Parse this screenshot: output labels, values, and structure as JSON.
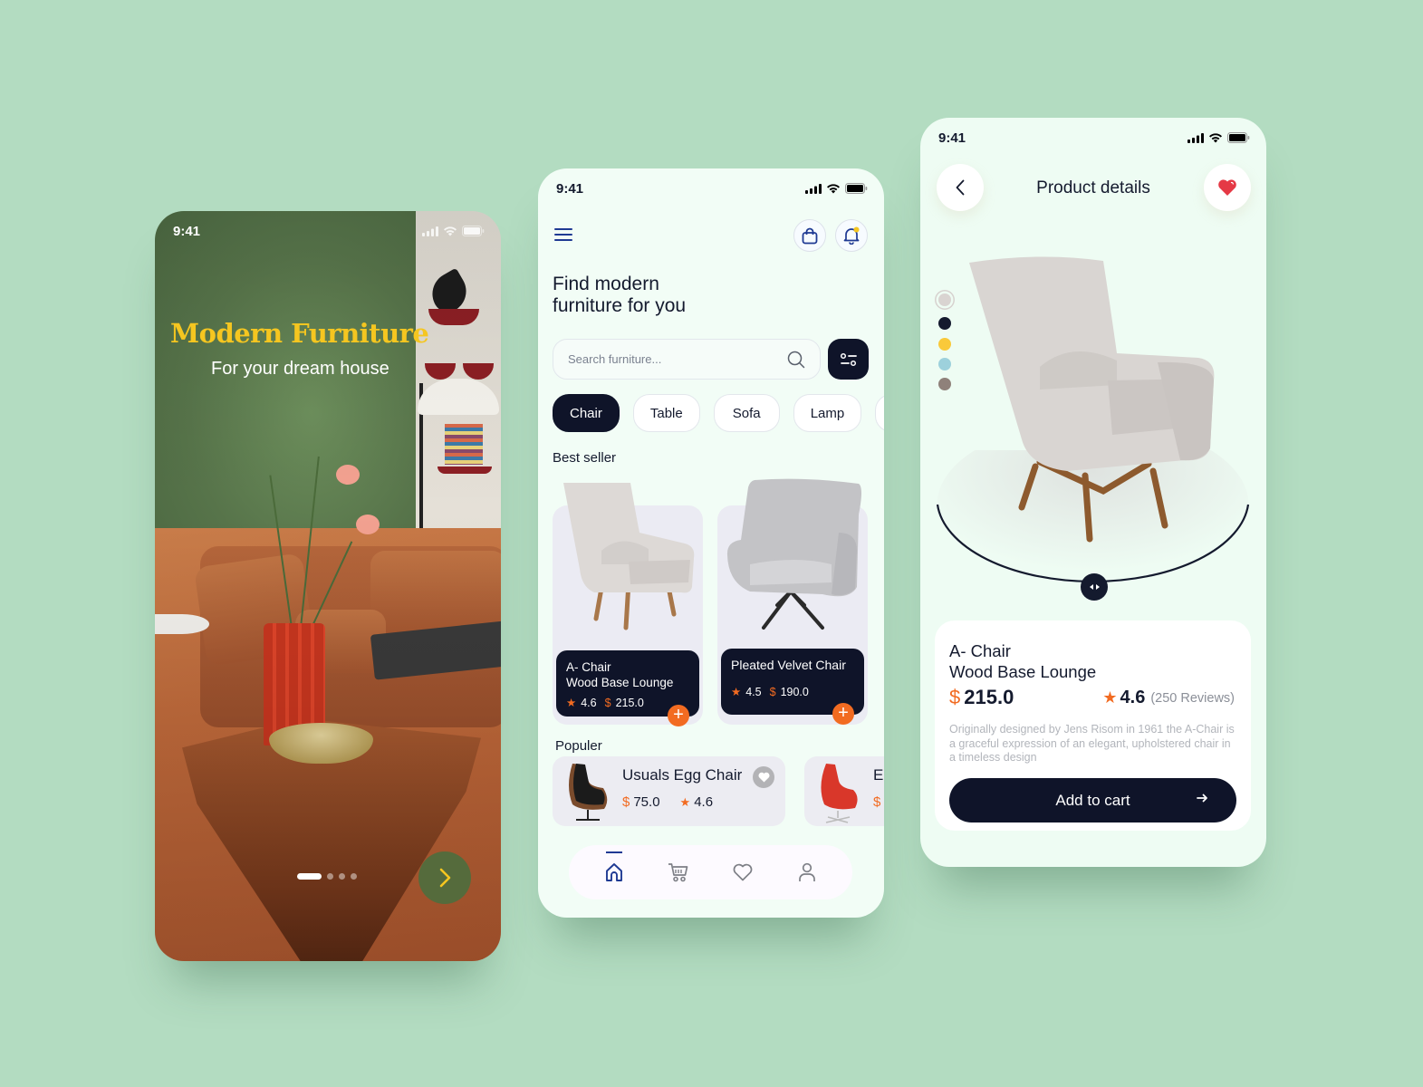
{
  "status_bar": {
    "time": "9:41"
  },
  "onboarding": {
    "title": "Modern Furniture",
    "subtitle": "For your dream house",
    "pager": {
      "total": 4,
      "active": 1
    },
    "next_icon": "chevron-right-icon",
    "colors": {
      "title": "#f5c620",
      "next_button": "#556b3c",
      "next_arrow": "#f5c620"
    }
  },
  "home": {
    "heading_line1": "Find modern",
    "heading_line2": "furniture for you",
    "search": {
      "placeholder": "Search furniture...",
      "value": ""
    },
    "categories": [
      {
        "label": "Chair",
        "active": true
      },
      {
        "label": "Table",
        "active": false
      },
      {
        "label": "Sofa",
        "active": false
      },
      {
        "label": "Lamp",
        "active": false
      },
      {
        "label": "",
        "active": false
      }
    ],
    "best_seller_label": "Best seller",
    "best_sellers": [
      {
        "name_line1": "A- Chair",
        "name_line2": "Wood Base Lounge",
        "rating": "4.6",
        "currency": "$",
        "price": "215.0"
      },
      {
        "name_line1": "Pleated Velvet Chair",
        "name_line2": "",
        "rating": "4.5",
        "currency": "$",
        "price": "190.0"
      }
    ],
    "popular_label": "Populer",
    "popular": [
      {
        "name": "Usuals Egg Chair",
        "currency": "$",
        "price": "75.0",
        "rating": "4.6"
      },
      {
        "name": "E",
        "currency": "$",
        "price": "",
        "rating": ""
      }
    ],
    "nav": [
      {
        "icon": "home-icon",
        "active": true
      },
      {
        "icon": "cart-icon",
        "active": false
      },
      {
        "icon": "heart-icon",
        "active": false
      },
      {
        "icon": "user-icon",
        "active": false
      }
    ],
    "colors": {
      "primary": "#0f1429",
      "accent": "#f26b21",
      "icon_blue": "#1f3a93",
      "notification_dot": "#f5c620"
    }
  },
  "details": {
    "title": "Product details",
    "swatches": [
      "#d9d4d1",
      "#141a2e",
      "#f9c93a",
      "#9dd1dc",
      "#8f817a"
    ],
    "selected_swatch": 0,
    "product_name_line1": "A- Chair",
    "product_name_line2": "Wood Base Lounge",
    "currency": "$",
    "price": "215.0",
    "rating": "4.6",
    "reviews": "(250 Reviews)",
    "description": "Originally designed by Jens Risom in 1961 the A-Chair is a graceful expression of an elegant, upholstered chair in a timeless design",
    "add_to_cart": "Add to cart",
    "colors": {
      "favorite": "#e53945",
      "accent": "#f26b21",
      "button": "#0f1429"
    }
  }
}
